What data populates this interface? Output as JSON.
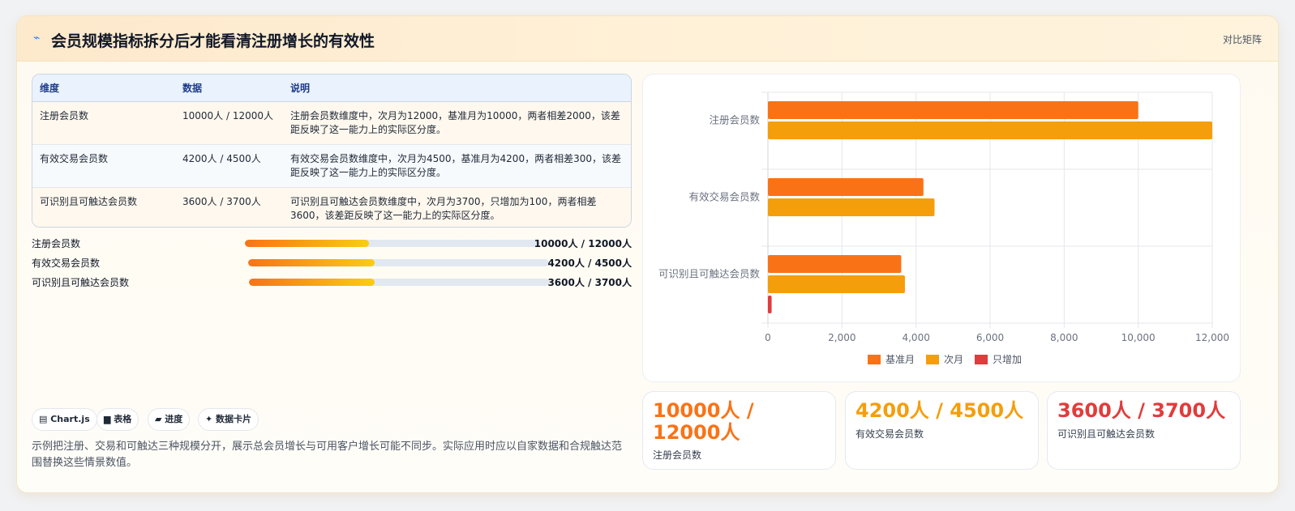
{
  "header": {
    "title": "会员规模指标拆分后才能看清注册增长的有效性",
    "right_link": "对比矩阵"
  },
  "table": {
    "columns": [
      "维度",
      "数据",
      "说明"
    ],
    "rows": [
      {
        "dimension": "注册会员数",
        "data": "10000人 / 12000人",
        "note": "注册会员数维度中，次月为12000，基准月为10000，两者相差2000，该差距反映了这一能力上的实际区分度。"
      },
      {
        "dimension": "有效交易会员数",
        "data": "4200人 / 4500人",
        "note": "有效交易会员数维度中，次月为4500，基准月为4200，两者相差300，该差距反映了这一能力上的实际区分度。"
      },
      {
        "dimension": "可识别且可触达会员数",
        "data": "3600人 / 3700人",
        "note": "可识别且可触达会员数维度中，次月为3700，只增加为100，两者相差3600，该差距反映了这一能力上的实际区分度。"
      }
    ]
  },
  "progress": [
    {
      "label": "注册会员数",
      "value": "10000人 / 12000人",
      "fraction": 0.42
    },
    {
      "label": "有效交易会员数",
      "value": "4200人 / 4500人",
      "fraction": 0.42
    },
    {
      "label": "可识别且可触达会员数",
      "value": "3600人 / 3700人",
      "fraction": 0.42
    }
  ],
  "tags": [
    "Chart.js",
    "表格",
    "进度",
    "数据卡片"
  ],
  "description": "示例把注册、交易和可触达三种规模分开，展示总会员增长与可用客户增长可能不同步。实际应用时应以自家数据和合规触达范围替换这些情景数值。",
  "stats": [
    {
      "value": "10000人 / 12000人",
      "label": "注册会员数",
      "color": "#f97316"
    },
    {
      "value": "4200人 / 4500人",
      "label": "有效交易会员数",
      "color": "#f59e0b"
    },
    {
      "value": "3600人 / 3700人",
      "label": "可识别且可触达会员数",
      "color": "#e23b3b"
    }
  ],
  "chart_data": {
    "type": "bar",
    "orientation": "horizontal",
    "categories": [
      "注册会员数",
      "有效交易会员数",
      "可识别且可触达会员数"
    ],
    "series": [
      {
        "name": "基准月",
        "values": [
          10000,
          4200,
          3600
        ],
        "color": "#f97316"
      },
      {
        "name": "次月",
        "values": [
          12000,
          4500,
          3700
        ],
        "color": "#f59e0b"
      },
      {
        "name": "只增加",
        "values": [
          null,
          null,
          100
        ],
        "color": "#e23b3b"
      }
    ],
    "xlim": [
      0,
      12000
    ],
    "xticks": [
      "0",
      "2,000",
      "4,000",
      "6,000",
      "8,000",
      "10,000",
      "12,000"
    ],
    "grid": true,
    "legend": "bottom"
  }
}
